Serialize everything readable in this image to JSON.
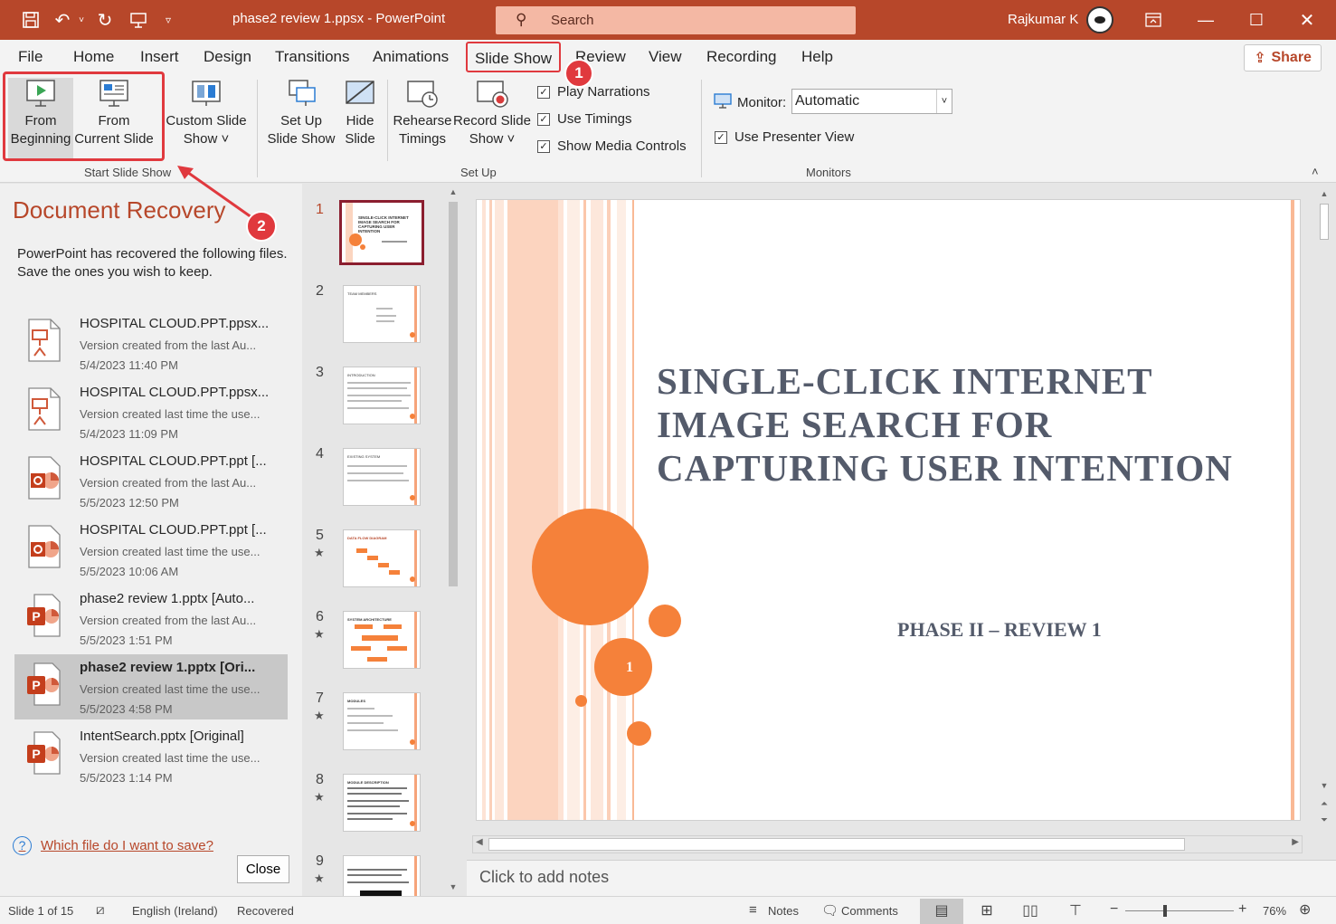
{
  "titlebar": {
    "doc_title": "phase2 review 1.ppsx  -  PowerPoint",
    "search_placeholder": "Search",
    "user_name": "Rajkumar K"
  },
  "tabs": [
    "File",
    "Home",
    "Insert",
    "Design",
    "Transitions",
    "Animations",
    "Slide Show",
    "Review",
    "View",
    "Recording",
    "Help"
  ],
  "active_tab": "Slide Show",
  "share_label": "Share",
  "ribbon": {
    "start_group": {
      "label": "Start Slide Show",
      "from_beginning": [
        "From",
        "Beginning"
      ],
      "from_current": [
        "From",
        "Current Slide"
      ],
      "custom_show": [
        "Custom Slide",
        "Show ˅"
      ]
    },
    "setup_group": {
      "label": "Set Up",
      "set_up": [
        "Set Up",
        "Slide Show"
      ],
      "hide_slide": [
        "Hide",
        "Slide"
      ],
      "rehearse": [
        "Rehearse",
        "Timings"
      ],
      "record": [
        "Record Slide",
        "Show ˅"
      ],
      "play_narrations": "Play Narrations",
      "use_timings": "Use Timings",
      "show_media_controls": "Show Media Controls"
    },
    "monitors_group": {
      "label": "Monitors",
      "monitor_label": "Monitor:",
      "monitor_value": "Automatic",
      "presenter_view": "Use Presenter View"
    }
  },
  "annotations": {
    "badge1": "1",
    "badge2": "2"
  },
  "recovery": {
    "title": "Document Recovery",
    "description": "PowerPoint has recovered the following files.  Save the ones you wish to keep.",
    "items": [
      {
        "name": "HOSPITAL CLOUD.PPT.ppsx...",
        "detail": "Version created from the last Au...",
        "time": "5/4/2023 11:40 PM",
        "icon": "ppsx-file-icon"
      },
      {
        "name": "HOSPITAL CLOUD.PPT.ppsx...",
        "detail": "Version created last time the use...",
        "time": "5/4/2023 11:09 PM",
        "icon": "ppsx-file-icon"
      },
      {
        "name": "HOSPITAL CLOUD.PPT.ppt  [...",
        "detail": "Version created from the last Au...",
        "time": "5/5/2023 12:50 PM",
        "icon": "ppt-file-icon"
      },
      {
        "name": "HOSPITAL CLOUD.PPT.ppt  [...",
        "detail": "Version created last time the use...",
        "time": "5/5/2023 10:06 AM",
        "icon": "ppt-file-icon"
      },
      {
        "name": "phase2 review 1.pptx  [Auto...",
        "detail": "Version created from the last Au...",
        "time": "5/5/2023 1:51 PM",
        "icon": "pptx-file-icon"
      },
      {
        "name": "phase2 review 1.pptx  [Ori...",
        "detail": "Version created last time the use...",
        "time": "5/5/2023 4:58 PM",
        "icon": "pptx-file-icon"
      },
      {
        "name": "IntentSearch.pptx  [Original]",
        "detail": "Version created last time the use...",
        "time": "5/5/2023 1:14 PM",
        "icon": "pptx-file-icon"
      }
    ],
    "selected_index": 5,
    "help_link": "Which file do I want to save?",
    "close_label": "Close"
  },
  "thumbnails": [
    {
      "num": "1",
      "star": "",
      "title": "SINGLE-CLICK INTERNET IMAGE SEARCH FOR CAPTURING USER INTENTION"
    },
    {
      "num": "2",
      "star": "",
      "title": "TEAM MEMBERS"
    },
    {
      "num": "3",
      "star": "",
      "title": "INTRODUCTION"
    },
    {
      "num": "4",
      "star": "",
      "title": "EXISTING SYSTEM"
    },
    {
      "num": "5",
      "star": "★",
      "title": "DATA FLOW DIAGRAM"
    },
    {
      "num": "6",
      "star": "★",
      "title": "SYSTEM ARCHITECTURE"
    },
    {
      "num": "7",
      "star": "★",
      "title": "MODULES"
    },
    {
      "num": "8",
      "star": "★",
      "title": "MODULE DESCRIPTION"
    },
    {
      "num": "9",
      "star": "★",
      "title": ""
    }
  ],
  "slide": {
    "title": "SINGLE-CLICK INTERNET IMAGE SEARCH FOR CAPTURING  USER INTENTION",
    "subtitle": "PHASE II – REVIEW 1",
    "number": "1"
  },
  "notes_placeholder": "Click to add notes",
  "status": {
    "slide_info": "Slide 1 of 15",
    "language": "English (Ireland)",
    "state": "Recovered",
    "notes": "Notes",
    "comments": "Comments",
    "zoom": "76%",
    "zoom_level": 0.76
  },
  "colors": {
    "accent": "#b7472a",
    "highlight": "#e0393e",
    "slide_orange": "#f5813a"
  }
}
